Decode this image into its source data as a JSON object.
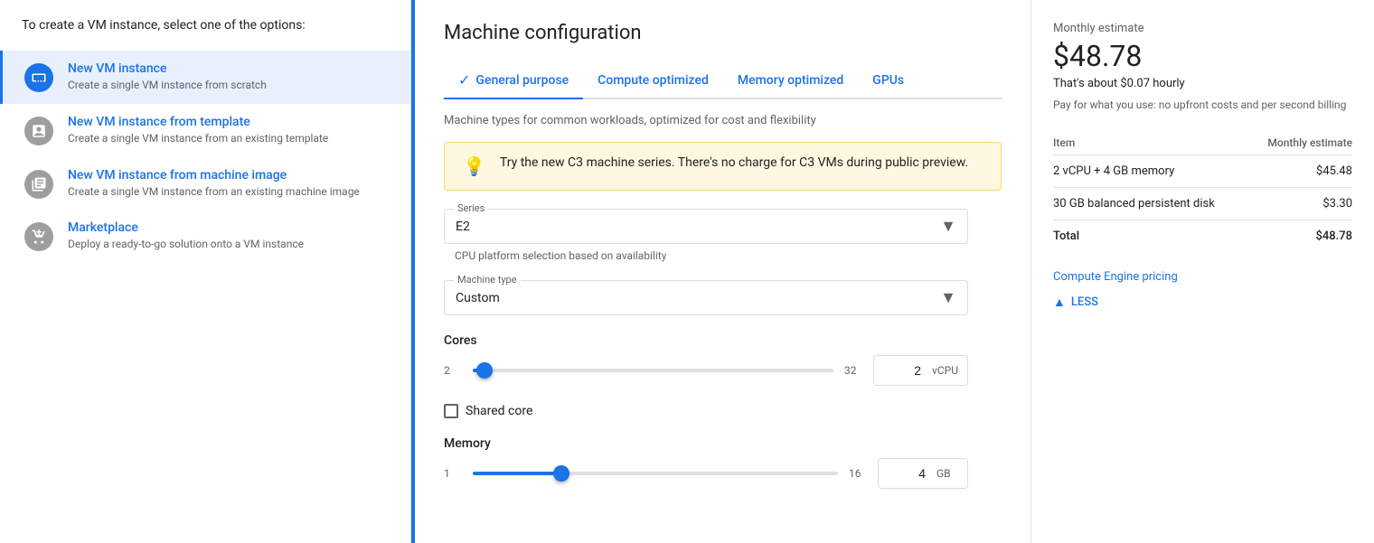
{
  "sidebar": {
    "intro": "To create a VM instance, select one of the options:",
    "items": [
      {
        "id": "new-vm",
        "title": "New VM instance",
        "subtitle": "Create a single VM instance from scratch",
        "active": true,
        "icon": "vm-icon"
      },
      {
        "id": "new-vm-template",
        "title": "New VM instance from template",
        "subtitle": "Create a single VM instance from an existing template",
        "active": false,
        "icon": "template-icon"
      },
      {
        "id": "new-vm-image",
        "title": "New VM instance from machine image",
        "subtitle": "Create a single VM instance from an existing machine image",
        "active": false,
        "icon": "image-icon"
      },
      {
        "id": "marketplace",
        "title": "Marketplace",
        "subtitle": "Deploy a ready-to-go solution onto a VM instance",
        "active": false,
        "icon": "marketplace-icon"
      }
    ]
  },
  "main": {
    "title": "Machine configuration",
    "tabs": [
      {
        "id": "general",
        "label": "General purpose",
        "active": true
      },
      {
        "id": "compute",
        "label": "Compute optimized",
        "active": false
      },
      {
        "id": "memory",
        "label": "Memory optimized",
        "active": false
      },
      {
        "id": "gpus",
        "label": "GPUs",
        "active": false
      }
    ],
    "machine_description": "Machine types for common workloads, optimized for cost and flexibility",
    "banner": {
      "icon": "💡",
      "text": "Try the new C3 machine series. There's no charge for C3 VMs during public preview."
    },
    "series_label": "Series",
    "series_value": "E2",
    "series_hint": "CPU platform selection based on availability",
    "machine_type_label": "Machine type",
    "machine_type_value": "Custom",
    "cores": {
      "label": "Cores",
      "min": "2",
      "max": "32",
      "value": "2",
      "unit": "vCPU",
      "thumb_pct": 2
    },
    "shared_core": {
      "label": "Shared core",
      "checked": false
    },
    "memory": {
      "label": "Memory",
      "min": "1",
      "max": "16",
      "value": "4",
      "unit": "GB",
      "thumb_pct": 23
    }
  },
  "right_panel": {
    "estimate_title": "Monthly estimate",
    "estimate_amount": "$48.78",
    "estimate_hourly": "That's about $0.07 hourly",
    "estimate_note": "Pay for what you use: no upfront costs and per second billing",
    "table": {
      "headers": [
        "Item",
        "Monthly estimate"
      ],
      "rows": [
        {
          "item": "2 vCPU + 4 GB memory",
          "cost": "$45.48"
        },
        {
          "item": "30 GB balanced persistent disk",
          "cost": "$3.30"
        }
      ],
      "total_label": "Total",
      "total_cost": "$48.78"
    },
    "pricing_link": "Compute Engine pricing",
    "less_label": "LESS"
  }
}
